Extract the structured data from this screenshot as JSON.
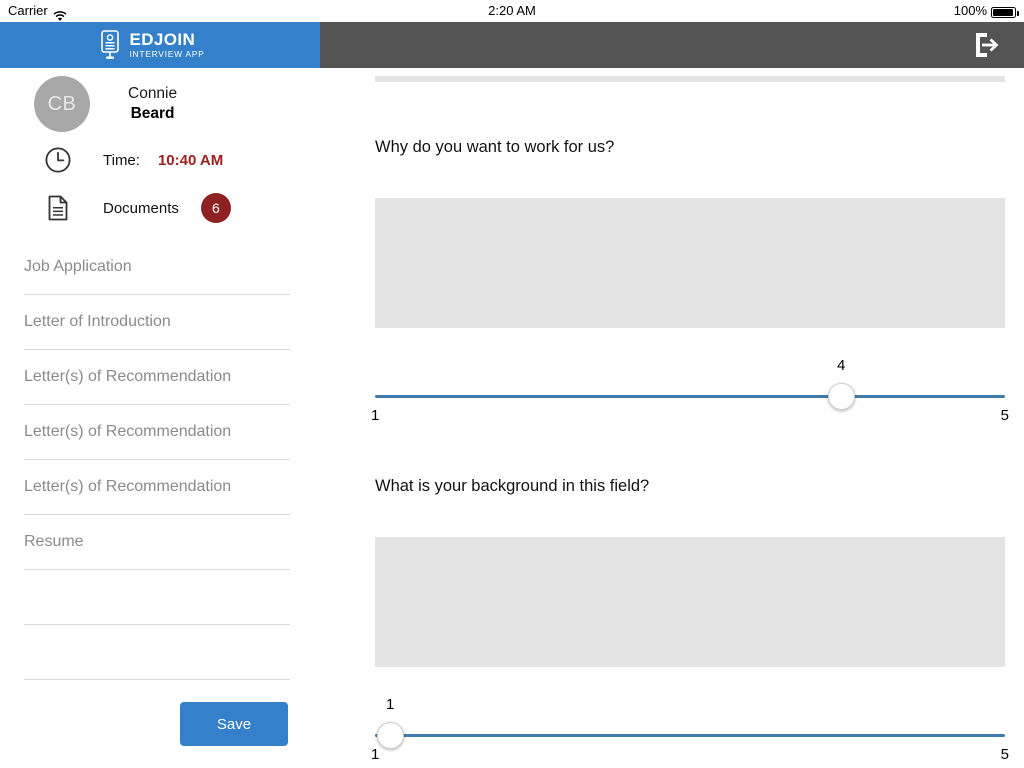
{
  "status_bar": {
    "carrier": "Carrier",
    "wifi_icon": "wifi-icon",
    "time": "2:20 AM",
    "battery_percent": "100%",
    "battery_icon": "battery-full-icon"
  },
  "app_bar": {
    "brand_color": "#3580ca",
    "bar_color": "#545454",
    "logo_icon": "edjoin-id-card-icon",
    "logo_title": "EDJOIN",
    "logo_subtitle": "INTERVIEW APP",
    "logout_icon": "logout-icon"
  },
  "sidebar": {
    "avatar": {
      "initials": "CB",
      "color": "#a8a8a8"
    },
    "candidate": {
      "first_name": "Connie",
      "last_name": "Beard"
    },
    "time_row": {
      "icon": "clock-icon",
      "label": "Time:",
      "value": "10:40 AM",
      "value_color": "#9b2020"
    },
    "documents_row": {
      "icon": "document-icon",
      "label": "Documents",
      "count": "6",
      "badge_color": "#8e2121"
    },
    "documents": [
      {
        "label": "Job Application"
      },
      {
        "label": "Letter of Introduction"
      },
      {
        "label": "Letter(s) of Recommendation"
      },
      {
        "label": "Letter(s) of Recommendation"
      },
      {
        "label": "Letter(s) of Recommendation"
      },
      {
        "label": "Resume"
      },
      {
        "label": ""
      },
      {
        "label": ""
      }
    ],
    "save_label": "Save",
    "save_color": "#3580ca"
  },
  "content": {
    "questions": [
      {
        "text": "Why do you want to work for us?",
        "answer": "",
        "answer_placeholder": "",
        "rating": {
          "value": "4",
          "min_label": "1",
          "max_label": "5",
          "min": 1,
          "max": 5,
          "track_color": "#3f7cab"
        }
      },
      {
        "text": "What is your background in this field?",
        "answer": "",
        "answer_placeholder": "",
        "rating": {
          "value": "1",
          "min_label": "1",
          "max_label": "5",
          "min": 1,
          "max": 5,
          "track_color": "#3f7cab"
        }
      }
    ]
  }
}
